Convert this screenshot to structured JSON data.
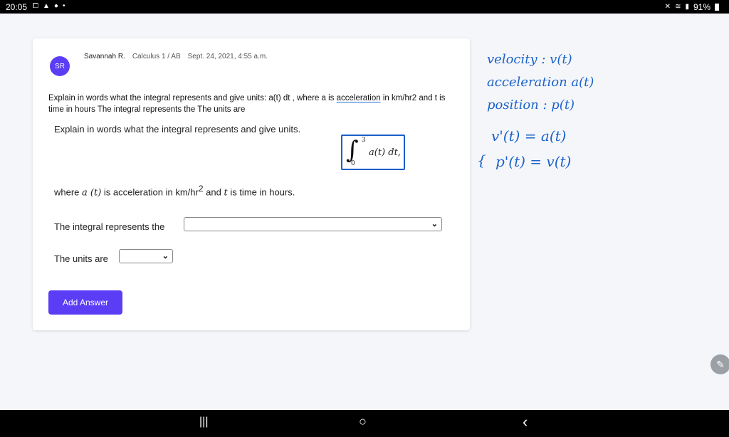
{
  "status_bar": {
    "time": "20:05",
    "left_icons": [
      "screenshot-icon",
      "image-icon",
      "messenger-icon",
      "dot-icon"
    ],
    "right_icons": [
      "mute-icon",
      "wifi-icon",
      "signal-icon"
    ],
    "battery": "91%"
  },
  "post": {
    "avatar_initials": "SR",
    "author": "Savannah R.",
    "course": "Calculus 1 / AB",
    "date": "Sept. 24, 2021, 4:55 a.m.",
    "question_part1": "Explain in words what the integral represents and give units: a(t) dt , where a is ",
    "question_highlight": "acceleration",
    "question_part2": " in km/hr2 and t is time in hours The integral represents the The units are"
  },
  "problem": {
    "heading": "Explain in words what the integral represents and give units.",
    "integral_upper": "3",
    "integral_lower": "0",
    "integral_body": "a(t) dt,",
    "where_prefix": "where ",
    "where_a": "a (t)",
    "where_mid": " is acceleration in km/hr",
    "where_exp": "2",
    "where_and": " and ",
    "where_t": "t",
    "where_suffix": " is time in hours.",
    "integral_label": "The integral represents the",
    "integral_select_value": "",
    "units_label": "The units are",
    "units_select_value": ""
  },
  "actions": {
    "add_answer": "Add Answer"
  },
  "notes": {
    "line1": "velocity :  v(t)",
    "line2": "acceleration  a(t)",
    "line3": "position :  p(t)",
    "line4": "v'(t) = a(t)",
    "line5_brace": "{",
    "line5": "p'(t) = v(t)"
  },
  "nav": {
    "recent": "|||",
    "home": "○",
    "back": "‹"
  },
  "colors": {
    "accent": "#5b3df5",
    "ink": "#1c63c9"
  }
}
